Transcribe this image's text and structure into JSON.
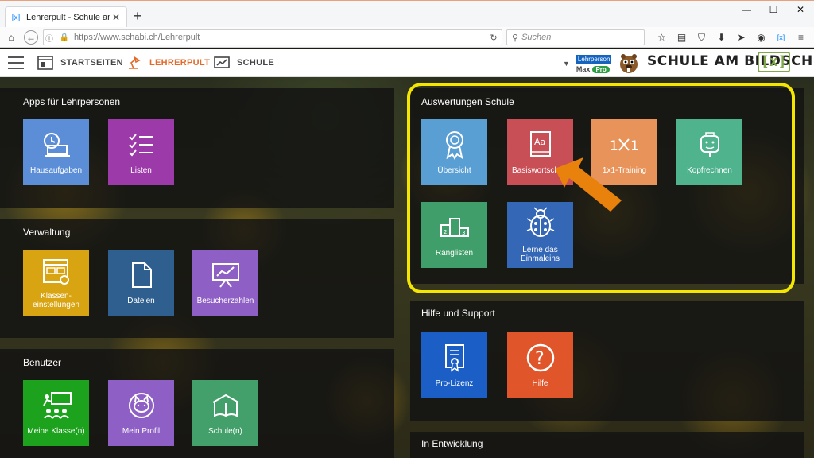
{
  "browser": {
    "tab_title": "Lehrerpult - Schule am Bild",
    "url": "https://www.schabi.ch/Lehrerpult",
    "search_placeholder": "Suchen"
  },
  "header": {
    "nav": [
      {
        "label": "STARTSEITEN"
      },
      {
        "label": "LEHRERPULT"
      },
      {
        "label": "SCHULE"
      }
    ],
    "account": {
      "role": "Lehrperson",
      "name": "Max",
      "badge": "Pro"
    },
    "logo_text": "SCHULE AM BILDSCHIRM",
    "logo_bracket": "[x]"
  },
  "sections": {
    "apps": {
      "title": "Apps für Lehrpersonen",
      "tiles": [
        {
          "label": "Hausaufgaben",
          "color": "#5b8ed6",
          "icon": "clock-laptop-icon"
        },
        {
          "label": "Listen",
          "color": "#9b3aa8",
          "icon": "checklist-icon"
        }
      ]
    },
    "verwaltung": {
      "title": "Verwaltung",
      "tiles": [
        {
          "label": "Klassen-\neinstellungen",
          "color": "#d9a411",
          "icon": "class-settings-icon"
        },
        {
          "label": "Dateien",
          "color": "#2f5f8e",
          "icon": "file-icon"
        },
        {
          "label": "Besucherzahlen",
          "color": "#8e5fc4",
          "icon": "presentation-chart-icon"
        }
      ]
    },
    "benutzer": {
      "title": "Benutzer",
      "tiles": [
        {
          "label": "Meine Klasse(n)",
          "color": "#1da21d",
          "icon": "classroom-icon"
        },
        {
          "label": "Mein Profil",
          "color": "#8e5fc4",
          "icon": "cat-profile-icon"
        },
        {
          "label": "Schule(n)",
          "color": "#43a06a",
          "icon": "book-house-icon"
        }
      ]
    },
    "auswertungen": {
      "title": "Auswertungen Schule",
      "tiles": [
        {
          "label": "Übersicht",
          "color": "#5a9fd4",
          "icon": "award-icon"
        },
        {
          "label": "Basiswortschatz",
          "color": "#c94f57",
          "icon": "dictionary-icon"
        },
        {
          "label": "1x1-Training",
          "color": "#e8935a",
          "icon": "times-table-icon"
        },
        {
          "label": "Kopfrechnen",
          "color": "#4fb38e",
          "icon": "head-icon"
        },
        {
          "label": "Ranglisten",
          "color": "#3f9e6a",
          "icon": "podium-icon"
        },
        {
          "label": "Lerne das Einmaleins",
          "color": "#3567b7",
          "icon": "ladybug-icon"
        }
      ]
    },
    "hilfe": {
      "title": "Hilfe und Support",
      "tiles": [
        {
          "label": "Pro-Lizenz",
          "color": "#1b5fc6",
          "icon": "certificate-icon"
        },
        {
          "label": "Hilfe",
          "color": "#e0562a",
          "icon": "question-icon"
        }
      ]
    },
    "entwicklung": {
      "title": "In Entwicklung"
    }
  },
  "colors": {
    "highlight": "#f5e600",
    "arrow": "#e8820c",
    "accent": "#e36a2b"
  }
}
